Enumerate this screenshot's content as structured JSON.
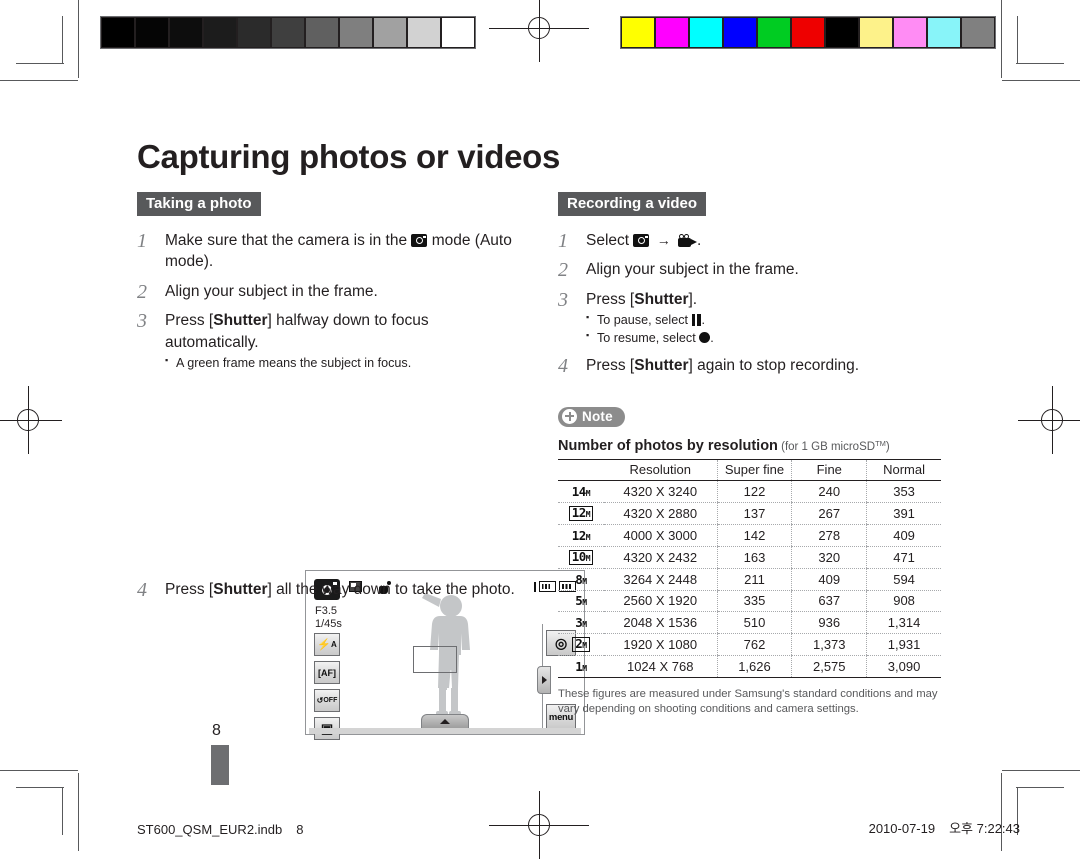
{
  "document": {
    "title": "Capturing photos or videos",
    "page_number": "8"
  },
  "calibration": {
    "gray_swatches": [
      "#000000",
      "#050505",
      "#0d0d0d",
      "#1c1c1c",
      "#2b2b2b",
      "#3f3f3f",
      "#606060",
      "#7f7f7f",
      "#a1a1a1",
      "#d2d2d2",
      "#ffffff"
    ],
    "color_swatches": [
      "#ffff00",
      "#ff00ff",
      "#00ffff",
      "#0000ff",
      "#00cc22",
      "#ee0000",
      "#000000",
      "#fdf28a",
      "#ff8cf4",
      "#88f4f9",
      "#808080"
    ]
  },
  "left_column": {
    "section_label": "Taking a photo",
    "steps": [
      {
        "num": "1",
        "text_before": "Make sure that the camera is in the",
        "icon": "camera-icon",
        "text_after": "mode (Auto mode).",
        "subs": []
      },
      {
        "num": "2",
        "text_before": "Align your subject in the frame.",
        "subs": []
      },
      {
        "num": "3",
        "text_before": "Press [",
        "bold": "Shutter",
        "text_after": "] halfway down to focus automatically.",
        "subs": [
          "A green frame means the subject in focus."
        ]
      },
      {
        "num": "4",
        "text_before": "Press [",
        "bold": "Shutter",
        "text_after": "] all the way down to take the photo.",
        "subs": []
      }
    ]
  },
  "camera_screen": {
    "mode_icon": "camera-mode-icon",
    "top_icons": [
      "memory-card-icon",
      "shake-warning-icon"
    ],
    "aperture": "F3.5",
    "shutter_speed": "1/45s",
    "battery_icons": [
      "card-indicator",
      "battery-indicator"
    ],
    "left_buttons": [
      {
        "name": "flash-auto-button",
        "label": "⚡A"
      },
      {
        "name": "autofocus-button",
        "label": "AF"
      },
      {
        "name": "timer-off-button",
        "label": "OFF"
      },
      {
        "name": "image-quality-button",
        "label": ""
      }
    ],
    "right_buttons": [
      {
        "name": "smart-mode-button",
        "label": ""
      },
      {
        "name": "menu-button",
        "label": "menu"
      }
    ]
  },
  "right_column": {
    "section_label": "Recording a video",
    "steps": [
      {
        "num": "1",
        "text_before": "Select",
        "icon_from": "camera-icon",
        "arrow": "→",
        "icon_to": "video-camera-icon",
        "text_after": ".",
        "subs": []
      },
      {
        "num": "2",
        "text_before": "Align your subject in the frame.",
        "subs": []
      },
      {
        "num": "3",
        "text_before": "Press [",
        "bold": "Shutter",
        "text_after": "].",
        "subs": [
          {
            "text_before": "To pause, select",
            "icon": "pause-icon",
            "text_after": "."
          },
          {
            "text_before": "To resume, select",
            "icon": "record-icon",
            "text_after": "."
          }
        ]
      },
      {
        "num": "4",
        "text_before": "Press [",
        "bold": "Shutter",
        "text_after": "] again to stop recording.",
        "subs": []
      }
    ],
    "note_badge": "Note",
    "table_title": "Number of photos by resolution",
    "table_subtitle_prefix": " (for 1 GB microSD",
    "table_subtitle_sup": "TM",
    "table_subtitle_suffix": ")",
    "table": {
      "headers": [
        "Resolution",
        "Super fine",
        "Fine",
        "Normal"
      ],
      "rows": [
        {
          "icon": "14",
          "icon_sub": "M",
          "boxed": false,
          "resolution": "4320 X 3240",
          "super_fine": "122",
          "fine": "240",
          "normal": "353"
        },
        {
          "icon": "12",
          "icon_sub": "M",
          "boxed": true,
          "resolution": "4320 X 2880",
          "super_fine": "137",
          "fine": "267",
          "normal": "391"
        },
        {
          "icon": "12",
          "icon_sub": "M",
          "boxed": false,
          "resolution": "4000 X 3000",
          "super_fine": "142",
          "fine": "278",
          "normal": "409"
        },
        {
          "icon": "10",
          "icon_sub": "M",
          "boxed": true,
          "resolution": "4320 X 2432",
          "super_fine": "163",
          "fine": "320",
          "normal": "471"
        },
        {
          "icon": "8",
          "icon_sub": "M",
          "boxed": false,
          "resolution": "3264 X 2448",
          "super_fine": "211",
          "fine": "409",
          "normal": "594"
        },
        {
          "icon": "5",
          "icon_sub": "M",
          "boxed": false,
          "resolution": "2560 X 1920",
          "super_fine": "335",
          "fine": "637",
          "normal": "908"
        },
        {
          "icon": "3",
          "icon_sub": "M",
          "boxed": false,
          "resolution": "2048 X 1536",
          "super_fine": "510",
          "fine": "936",
          "normal": "1,314"
        },
        {
          "icon": "2",
          "icon_sub": "M",
          "boxed": true,
          "resolution": "1920 X 1080",
          "super_fine": "762",
          "fine": "1,373",
          "normal": "1,931"
        },
        {
          "icon": "1",
          "icon_sub": "M",
          "boxed": false,
          "resolution": "1024 X 768",
          "super_fine": "1,626",
          "fine": "2,575",
          "normal": "3,090"
        }
      ]
    },
    "table_footnote": "These figures are measured under Samsung's standard conditions and may vary depending on shooting conditions and camera settings."
  },
  "footer": {
    "file_name": "ST600_QSM_EUR2.indb",
    "page": "8",
    "date": "2010-07-19",
    "time": "오후 7:22:43"
  }
}
